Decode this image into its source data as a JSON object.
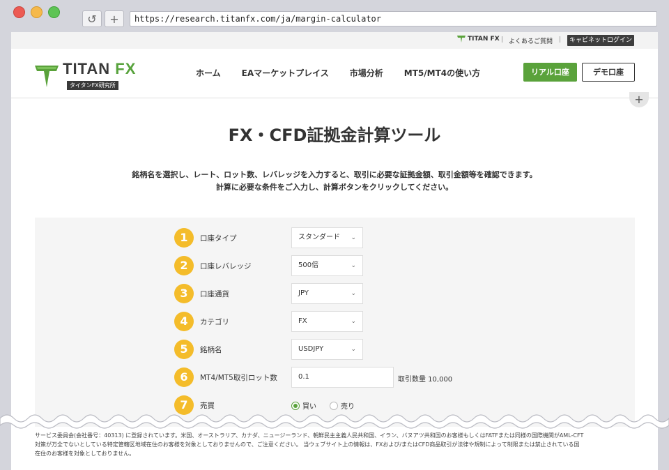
{
  "browser": {
    "url": "https://research.titanfx.com/ja/margin-calculator",
    "reload_icon": "↺",
    "newtab_icon": "+"
  },
  "topbar": {
    "logo_text": "TITAN FX",
    "separator": "|",
    "faq": "よくあるご質問",
    "cabinet_login": "キャビネットログイン"
  },
  "header": {
    "logo_main_a": "TITAN",
    "logo_main_b": "FX",
    "logo_sub": "タイタンFX研究所",
    "menu": [
      "ホーム",
      "EAマーケットプレイス",
      "市場分析",
      "MT5/MT4の使い方"
    ],
    "real_account": "リアル口座",
    "demo_account": "デモ口座",
    "plus": "+"
  },
  "main": {
    "title": "FX・CFD証拠金計算ツール",
    "desc_line1": "銘柄名を選択し、レート、ロット数、レバレッジを入力すると、取引に必要な証拠金額、取引金額等を確認できます。",
    "desc_line2": "計算に必要な条件をご入力し、計算ボタンをクリックしてください。"
  },
  "form": {
    "rows": [
      {
        "num": "1",
        "label": "口座タイプ",
        "value": "スタンダード"
      },
      {
        "num": "2",
        "label": "口座レバレッジ",
        "value": "500倍"
      },
      {
        "num": "3",
        "label": "口座通貨",
        "value": "JPY"
      },
      {
        "num": "4",
        "label": "カテゴリ",
        "value": "FX"
      },
      {
        "num": "5",
        "label": "銘柄名",
        "value": "USDJPY"
      },
      {
        "num": "6",
        "label": "MT4/MT5取引ロット数",
        "value": "0.1",
        "aside": "取引数量 10,000"
      },
      {
        "num": "7",
        "label": "売買",
        "buy": "買い",
        "sell": "売り"
      }
    ],
    "chevron": "⌄"
  },
  "footer": {
    "line1": "サービス委員会(会社番号：40313) に登録されています。米国、オーストラリア、カナダ、ニュージーランド、朝鮮民主主義人民共和国、イラン、バヌアツ共和国のお客様もしくはFATFまたは同様の国際機関がAML-CFT",
    "line2": "対策が万全でないとしている特定管轄区地域在住のお客様を対象としておりませんので、ご注意ください。 当ウェブサイト上の情報は、FXおよび/またはCFD商品取引が法律や規制によって制限または禁止されている国",
    "line3": "在住のお客様を対象としておりません。"
  },
  "colors": {
    "brand_green": "#5aa23b",
    "badge_yellow": "#f4bc2a",
    "dark": "#3d3d3d"
  }
}
